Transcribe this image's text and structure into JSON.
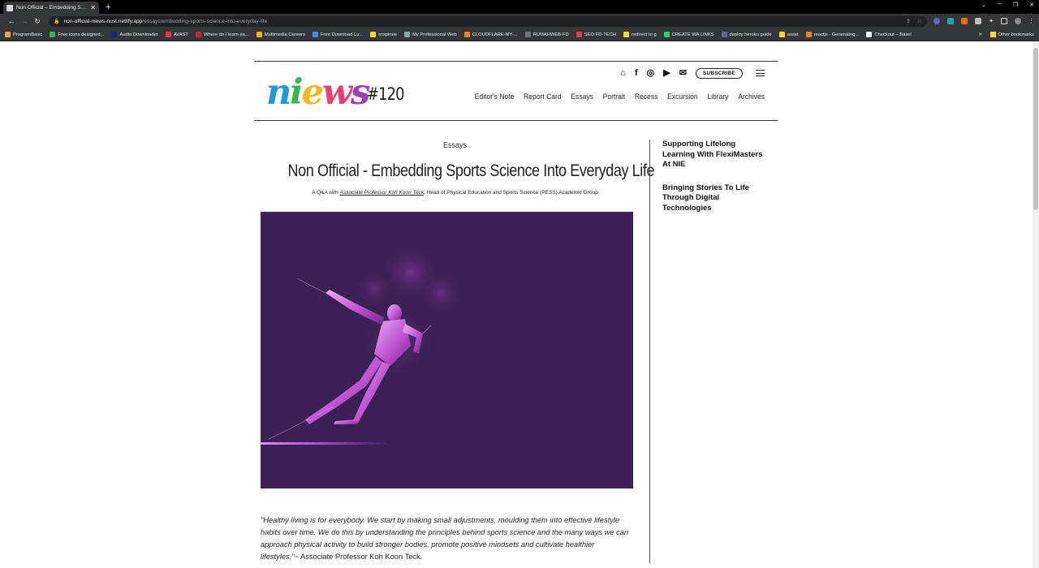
{
  "browser": {
    "tab_title": "Non Official – Embedding Sports",
    "url_host": "non-official-niews-nust.netlify.app",
    "url_path": "/essays/embedding-sports-science-into-everyday-life",
    "bookmarks": [
      {
        "label": "ProgramBasic",
        "color": "#e8a33d"
      },
      {
        "label": "Free icons designed...",
        "color": "#3bb54a"
      },
      {
        "label": "Audio Downloader",
        "color": "#1a237e"
      },
      {
        "label": "AVAST",
        "color": "#e53935"
      },
      {
        "label": "Where do I learn ea...",
        "color": "#c62828"
      },
      {
        "label": "Multimedia Careers",
        "color": "#f4b400"
      },
      {
        "label": "Free Download Lu...",
        "color": "#4285f4"
      },
      {
        "label": "rrrspinee",
        "color": "#fdd835"
      },
      {
        "label": "My Professional Web",
        "color": "#90a4ae"
      },
      {
        "label": "CLOUDFLARE-MY-...",
        "color": "#f6821f"
      },
      {
        "label": "RUMAHWEB-FD",
        "color": "#757575"
      },
      {
        "label": "SEO FD-TECH",
        "color": "#e53935"
      },
      {
        "label": "redirect to g",
        "color": "#fdd835"
      },
      {
        "label": "CREATE WA LINKS",
        "color": "#25d366"
      },
      {
        "label": "deploy heroku guide",
        "color": "#6762a6"
      },
      {
        "label": "asset",
        "color": "#fdd835"
      },
      {
        "label": "reactjs - Generating...",
        "color": "#f48024"
      },
      {
        "label": "Checkout – Basel",
        "color": "#eeeeee"
      }
    ],
    "other_bookmarks": "Other bookmarks"
  },
  "site": {
    "logo_text": [
      "n",
      "i",
      "e",
      "w",
      "s"
    ],
    "issue": "#120",
    "subscribe_label": "SUBSCRIBE",
    "nav": [
      "Editor's Note",
      "Report Card",
      "Essays",
      "Portrait",
      "Recess",
      "Excursion",
      "Library",
      "Archives"
    ]
  },
  "article": {
    "category": "Essays",
    "title": "Non Official - Embedding Sports Science Into Everyday Life",
    "byline_prefix": "A Q&A with ",
    "byline_link": "Associate Professor Koh Koon Teck",
    "byline_suffix": ", Head of Physical Education and Sports Science (PESS) Academic Group",
    "quote_italic": "\"Healthy living is for everybody. We start by making small adjustments, moulding them into effective lifestyle habits over time. We do this by understanding the principles behind sports science and the many ways we can approach physical activity to build stronger bodies, promote positive mindsets and cultivate healthier lifestyles.\"~",
    "quote_author": " Associate Professor Koh Koon Teck."
  },
  "sidebar": {
    "links": [
      "Supporting Lifelong Learning With FlexiMasters At NIE",
      "Bringing Stories To Life Through Digital Technologies"
    ]
  },
  "colors": {
    "hero_bg": "#3b1f55",
    "chrome_dark": "#35363a"
  }
}
